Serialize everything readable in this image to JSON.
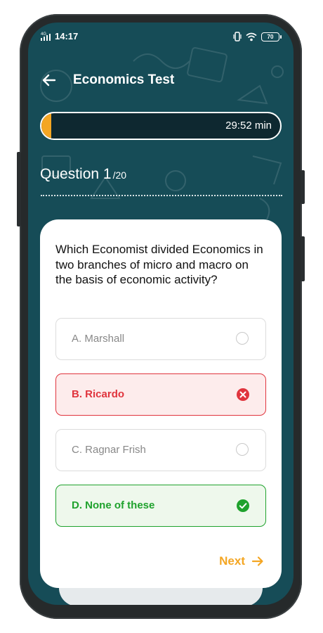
{
  "status_bar": {
    "network": "4G",
    "time": "14:17",
    "battery": "70"
  },
  "header": {
    "title": "Economics Test"
  },
  "timer": {
    "remaining": "29:52 min",
    "progress_fraction": 0.04
  },
  "question": {
    "label": "Question 1",
    "total": "/20",
    "text": "Which Economist divided Economics in two branches of micro and macro on the basis of economic activity?"
  },
  "options": [
    {
      "label": "A. Marshall",
      "state": "unselected"
    },
    {
      "label": "B. Ricardo",
      "state": "wrong"
    },
    {
      "label": "C. Ragnar Frish",
      "state": "unselected"
    },
    {
      "label": "D. None of these",
      "state": "correct"
    }
  ],
  "footer": {
    "next_label": "Next"
  },
  "colors": {
    "background": "#164c57",
    "accent": "#f4a623",
    "wrong": "#e0343d",
    "correct": "#1fa22d"
  }
}
